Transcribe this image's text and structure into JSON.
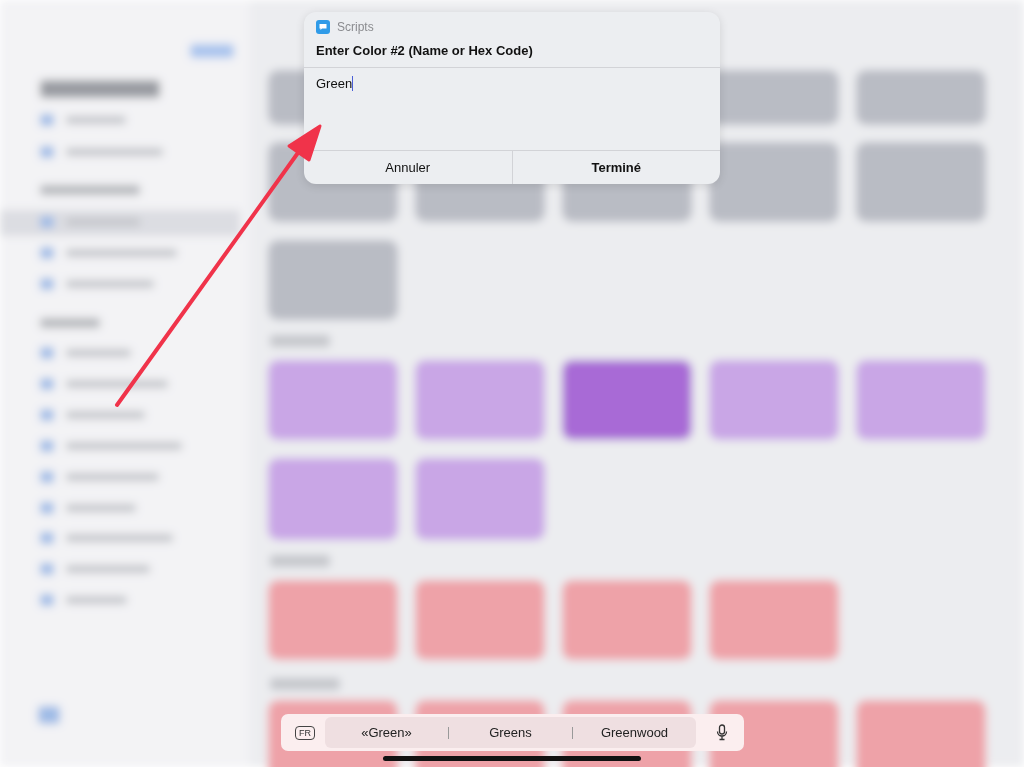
{
  "dialog": {
    "app_name": "Scripts",
    "title": "Enter Color #2 (Name or Hex Code)",
    "input": {
      "value": "Green"
    },
    "buttons": [
      {
        "label": "Annuler",
        "bold": false
      },
      {
        "label": "Terminé",
        "bold": true
      }
    ]
  },
  "keyboard_bar": {
    "language": "FR",
    "suggestions": [
      {
        "text": "«Green»"
      },
      {
        "text": "Greens"
      },
      {
        "text": "Greenwood"
      }
    ]
  }
}
